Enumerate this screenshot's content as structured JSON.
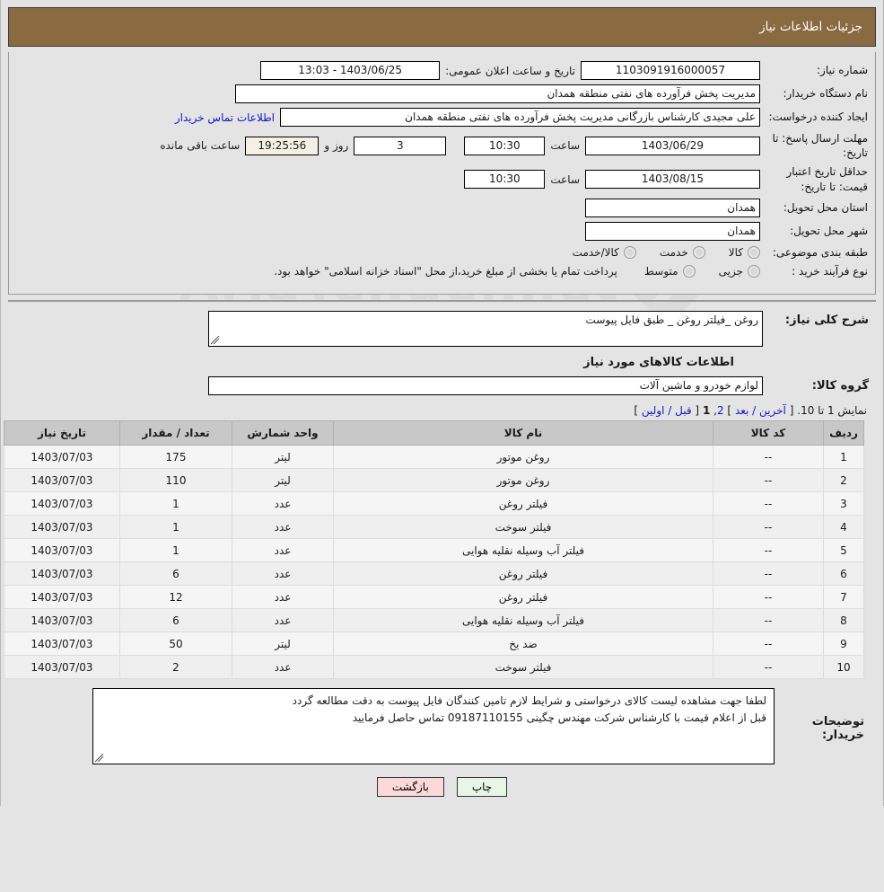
{
  "header": {
    "title": "جزئیات اطلاعات نیاز"
  },
  "info": {
    "need_number_label": "شماره نیاز:",
    "need_number_value": "1103091916000057",
    "announce_label": "تاریخ و ساعت اعلان عمومی:",
    "announce_value": "1403/06/25 - 13:03",
    "buyer_org_label": "نام دستگاه خریدار:",
    "buyer_org_value": "مدیریت پخش فرآورده های نفتی منطقه همدان",
    "creator_label": "ایجاد کننده درخواست:",
    "creator_value": "علی مجیدی کارشناس بازرگانی مدیریت پخش فرآورده های نفتی منطقه همدان",
    "contact_link": "اطلاعات تماس خریدار",
    "deadline_label": "مهلت ارسال پاسخ: تا تاریخ:",
    "deadline_date": "1403/06/29",
    "deadline_hour_label": "ساعت",
    "deadline_hour": "10:30",
    "days_value": "3",
    "days_label": "روز و",
    "seconds_value": "19:25:56",
    "remaining_label": "ساعت باقی مانده",
    "validity_label": "حداقل تاریخ اعتبار قیمت: تا تاریخ:",
    "validity_date": "1403/08/15",
    "validity_hour_label": "ساعت",
    "validity_hour": "10:30",
    "province_label": "استان محل تحویل:",
    "province_value": "همدان",
    "city_label": "شهر محل تحویل:",
    "city_value": "همدان",
    "category_label": "طبقه بندی موضوعی:",
    "category_options": [
      "کالا",
      "خدمت",
      "کالا/خدمت"
    ],
    "process_label": "نوع فرآیند خرید :",
    "process_options": [
      "جزیی",
      "متوسط"
    ],
    "process_note": "پرداخت تمام یا بخشی از مبلغ خرید،از محل \"اسناد خزانه اسلامی\" خواهد بود."
  },
  "body": {
    "summary_label": "شرح کلی نیاز:",
    "summary_value": "روغن _فیلتر روغن _ طبق فایل پیوست",
    "items_heading": "اطلاعات کالاهای مورد نیاز",
    "group_label": "گروه کالا:",
    "group_value": "لوازم خودرو و ماشین آلات"
  },
  "pagination": {
    "prefix": "نمایش 1 تا 10.",
    "last_link": "آخرین / بعد",
    "open_bracket": "[",
    "close_bracket": "]",
    "page_2": "2",
    "page_current": "1",
    "comma": ",",
    "first_link": "قبل / اولین"
  },
  "table": {
    "columns": [
      "ردیف",
      "کد کالا",
      "نام کالا",
      "واحد شمارش",
      "تعداد / مقدار",
      "تاریخ نیاز"
    ],
    "rows": [
      {
        "radif": "1",
        "code": "--",
        "name": "روغن موتور",
        "unit": "لیتر",
        "qty": "175",
        "date": "1403/07/03"
      },
      {
        "radif": "2",
        "code": "--",
        "name": "روغن موتور",
        "unit": "لیتر",
        "qty": "110",
        "date": "1403/07/03"
      },
      {
        "radif": "3",
        "code": "--",
        "name": "فیلتر روغن",
        "unit": "عدد",
        "qty": "1",
        "date": "1403/07/03"
      },
      {
        "radif": "4",
        "code": "--",
        "name": "فیلتر سوخت",
        "unit": "عدد",
        "qty": "1",
        "date": "1403/07/03"
      },
      {
        "radif": "5",
        "code": "--",
        "name": "فیلتر آب وسیله نقلیه هوایی",
        "unit": "عدد",
        "qty": "1",
        "date": "1403/07/03"
      },
      {
        "radif": "6",
        "code": "--",
        "name": "فیلتر روغن",
        "unit": "عدد",
        "qty": "6",
        "date": "1403/07/03"
      },
      {
        "radif": "7",
        "code": "--",
        "name": "فیلتر روغن",
        "unit": "عدد",
        "qty": "12",
        "date": "1403/07/03"
      },
      {
        "radif": "8",
        "code": "--",
        "name": "فیلتر آب وسیله نقلیه هوایی",
        "unit": "عدد",
        "qty": "6",
        "date": "1403/07/03"
      },
      {
        "radif": "9",
        "code": "--",
        "name": "ضد یخ",
        "unit": "لیتر",
        "qty": "50",
        "date": "1403/07/03"
      },
      {
        "radif": "10",
        "code": "--",
        "name": "فیلتر سوخت",
        "unit": "عدد",
        "qty": "2",
        "date": "1403/07/03"
      }
    ]
  },
  "notes": {
    "label": "توضیحات خریدار:",
    "line1": "لطفا جهت مشاهده لیست کالای درخواستی و شرایط لازم تامین کنندگان فایل پیوست به دقت مطالعه گردد",
    "line2": "قبل از اعلام قیمت با کارشناس شرکت مهندس چگینی 09187110155 تماس حاصل فرمایید"
  },
  "buttons": {
    "print": "چاپ",
    "back": "بازگشت"
  },
  "watermark": {
    "text": "AriaTender.net"
  },
  "colors": {
    "header_bg": "#8a6a40",
    "link": "#1414c8",
    "print_bg": "#e8f6e8",
    "back_bg": "#fbd9d9"
  }
}
